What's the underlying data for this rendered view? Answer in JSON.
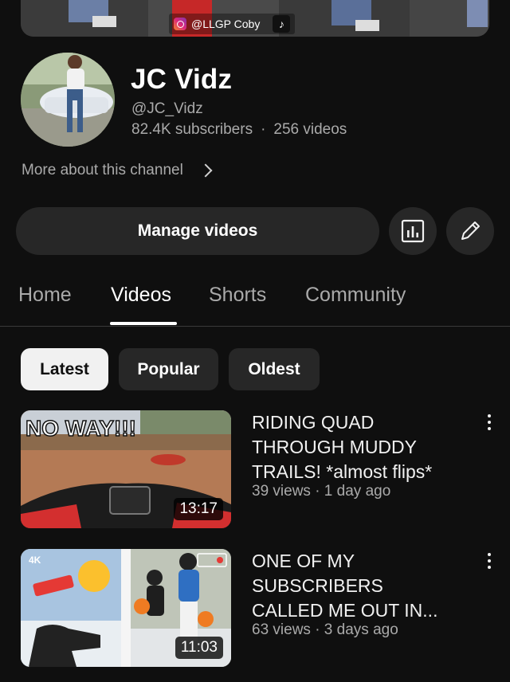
{
  "banner": {
    "handle": "@LLGP Coby",
    "icons": [
      "instagram-icon",
      "tiktok-icon"
    ]
  },
  "channel": {
    "name": "JC Vidz",
    "handle": "@JC_Vidz",
    "subscribers": "82.4K subscribers",
    "separator": "·",
    "videos": "256 videos",
    "more_about": "More about this channel"
  },
  "actions": {
    "manage_label": "Manage videos",
    "analytics_icon": "analytics-icon",
    "edit_icon": "pencil-icon"
  },
  "tabs": [
    {
      "label": "Home",
      "active": false
    },
    {
      "label": "Videos",
      "active": true
    },
    {
      "label": "Shorts",
      "active": false
    },
    {
      "label": "Community",
      "active": false
    }
  ],
  "filters": [
    {
      "label": "Latest",
      "selected": true
    },
    {
      "label": "Popular",
      "selected": false
    },
    {
      "label": "Oldest",
      "selected": false
    }
  ],
  "videos": [
    {
      "title_lines": [
        "RIDING QUAD",
        "THROUGH MUDDY",
        "TRAILS! *almost flips*"
      ],
      "meta": "39 views · 1 day ago",
      "duration": "13:17",
      "thumb_text": "NO WAY!!!"
    },
    {
      "title_lines": [
        "ONE OF MY",
        "SUBSCRIBERS",
        "CALLED ME OUT IN..."
      ],
      "meta": "63 views · 3 days ago",
      "duration": "11:03",
      "thumb_text": "4K"
    }
  ],
  "colors": {
    "background": "#0f0f0f",
    "surface": "#272727",
    "text_primary": "#f1f1f1",
    "text_secondary": "#aaaaaa",
    "thumb_accent": "#e53935"
  }
}
